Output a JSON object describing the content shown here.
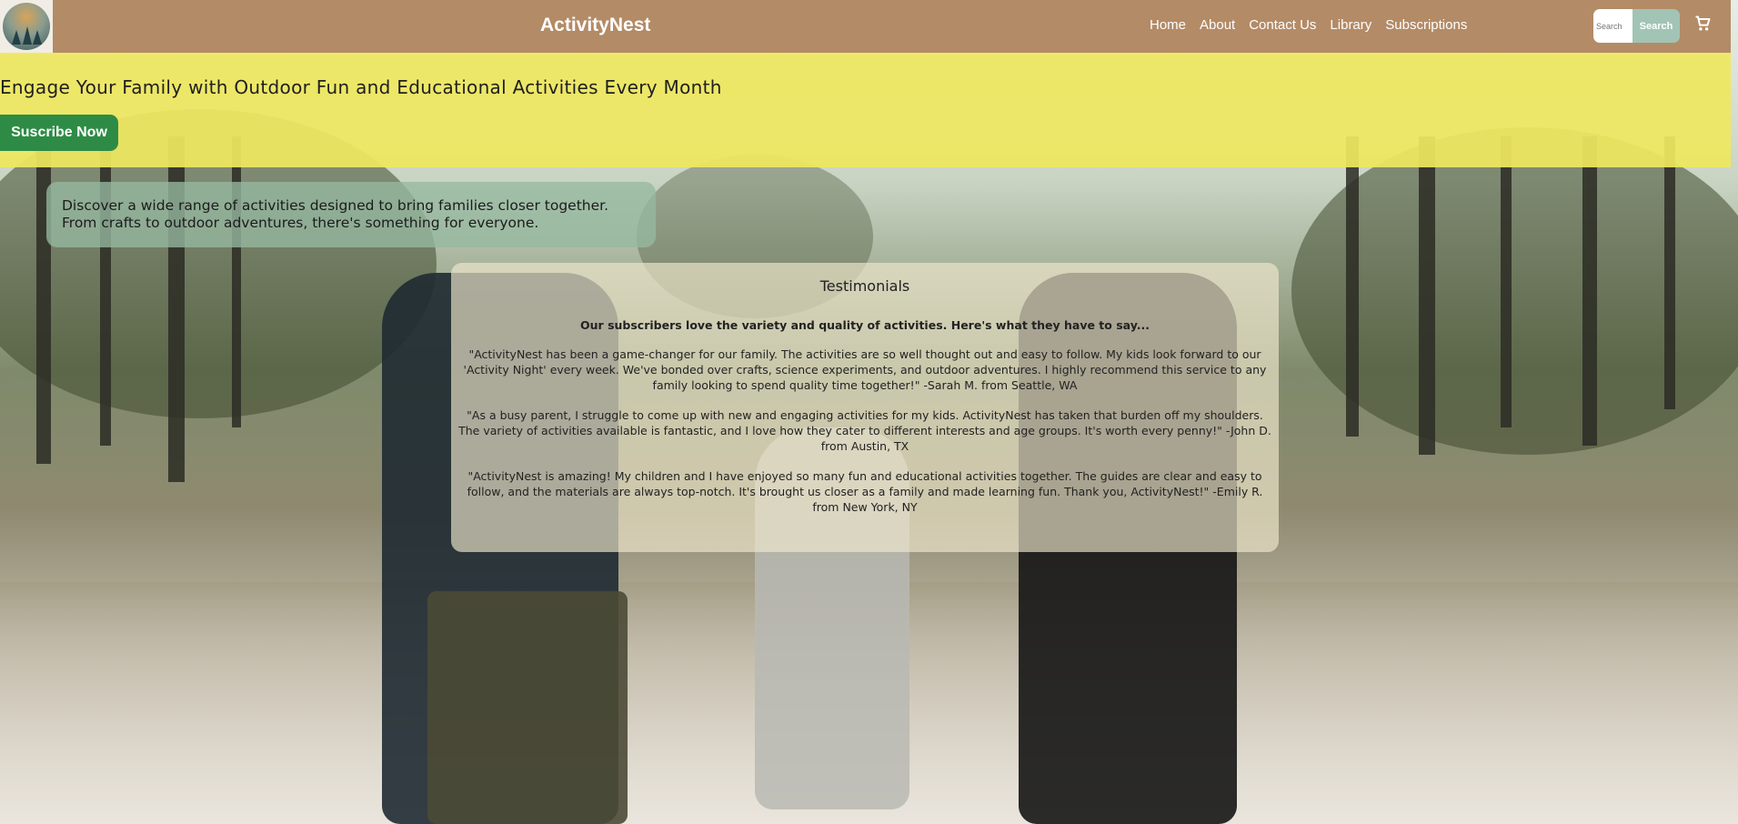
{
  "header": {
    "brand": "ActivityNest",
    "nav": [
      "Home",
      "About",
      "Contact Us",
      "Library",
      "Subscriptions"
    ],
    "search_placeholder": "Search",
    "search_button": "Search",
    "cart_icon": "shopping-cart-icon",
    "color": "#b38b66"
  },
  "hero": {
    "title": "Engage Your Family with Outdoor Fun and Educational Activities Every Month",
    "cta": "Suscribe Now",
    "color": "#eee760",
    "cta_color": "#2e8b45"
  },
  "intro": {
    "line1": "Discover a wide range of activities designed to bring families closer together.",
    "line2": "From crafts to outdoor adventures, there's something for everyone."
  },
  "testimonials": {
    "title": "Testimonials",
    "lead": "Our subscribers love the variety and quality of activities. Here's what they have to say...",
    "quotes": [
      "\"ActivityNest has been a game-changer for our family. The activities are so well thought out and easy to follow. My kids look forward to our 'Activity Night' every week. We've bonded over crafts, science experiments, and outdoor adventures. I highly recommend this service to any family looking to spend quality time together!\" -Sarah M. from Seattle, WA",
      "\"As a busy parent, I struggle to come up with new and engaging activities for my kids. ActivityNest has taken that burden off my shoulders. The variety of activities available is fantastic, and I love how they cater to different interests and age groups. It's worth every penny!\" -John D. from Austin, TX",
      "\"ActivityNest is amazing! My children and I have enjoyed so many fun and educational activities together. The guides are clear and easy to follow, and the materials are always top-notch. It's brought us closer as a family and made learning fun. Thank you, ActivityNest!\" -Emily R. from New York, NY"
    ]
  }
}
